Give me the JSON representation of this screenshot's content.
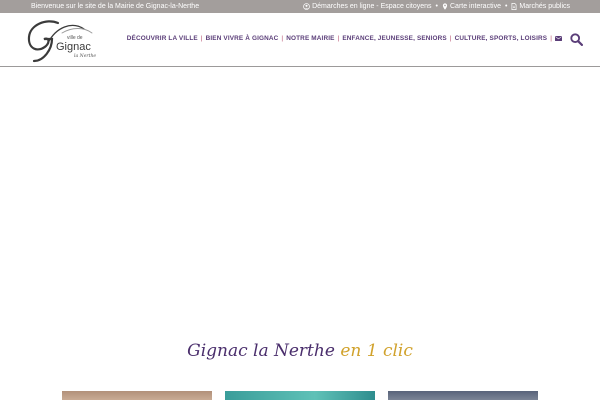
{
  "topbar": {
    "welcome": "Bienvenue sur le site de la Mairie de Gignac-la-Nerthe",
    "links": [
      {
        "label": "Démarches en ligne - Espace citoyens",
        "icon": "user-circle-icon"
      },
      {
        "label": "Carte interactive",
        "icon": "map-pin-icon"
      },
      {
        "label": "Marchés publics",
        "icon": "document-icon"
      }
    ],
    "separator": "•"
  },
  "logo": {
    "mark": "G",
    "line1": "ville de",
    "line2": "Gignac",
    "line3": "la Nerthe"
  },
  "nav": {
    "items": [
      "DÉCOUVRIR LA VILLE",
      "BIEN VIVRE À GIGNAC",
      "NOTRE MAIRIE",
      "ENFANCE, JEUNESSE, SENIORS",
      "CULTURE, SPORTS, LOISIRS"
    ],
    "separator": "|",
    "mail_icon": "envelope-icon",
    "search_icon": "search-icon"
  },
  "section": {
    "title_main": "Gignac la Nerthe",
    "title_accent": "en 1 clic"
  },
  "colors": {
    "topbar_bg": "#a39e9c",
    "nav_text": "#5a3d78",
    "nav_separator": "#b54a6b",
    "title_main": "#4a2e6c",
    "title_accent": "#d1a22c"
  }
}
